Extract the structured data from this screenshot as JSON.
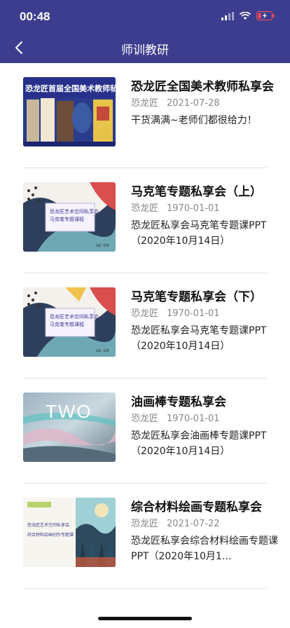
{
  "status": {
    "time": "00:48"
  },
  "nav": {
    "title": "师训教研"
  },
  "items": [
    {
      "title": "恐龙匠全国美术教师私享会",
      "author": "恐龙匠",
      "date": "2021-07-28",
      "desc": "干货满满~老师们都很给力！",
      "thumb_text": "恐龙匠首届全国美术教师私享会"
    },
    {
      "title": "马克笔专题私享会（上）",
      "author": "恐龙匠",
      "date": "1970-01-01",
      "desc": "恐龙匠私享会马克笔专题课PPT（2020年10月14日）",
      "thumb_line1": "恐龙匠艺术空间私享会",
      "thumb_line2": "马克笔专题课程",
      "thumb_sig": "uc ce"
    },
    {
      "title": "马克笔专题私享会（下）",
      "author": "恐龙匠",
      "date": "1970-01-01",
      "desc": "恐龙匠私享会马克笔专题课PPT（2020年10月14日）",
      "thumb_line1": "恐龙匠艺术空间私享会",
      "thumb_line2": "马克笔专题课程",
      "thumb_sig": "uc ce"
    },
    {
      "title": "油画棒专题私享会",
      "author": "恐龙匠",
      "date": "1970-01-01",
      "desc": "恐龙匠私享会油画棒专题课PPT（2020年10月14日）",
      "thumb_big": "TWO"
    },
    {
      "title": "综合材料绘画专题私享会",
      "author": "恐龙匠",
      "date": "2021-07-22",
      "desc": "恐龙匠私享会综合材料绘画专题课PPT（2020年10月1…",
      "thumb_line1": "恐龙匠艺术空间私享会",
      "thumb_line2": "综合材料绘画创作专题课"
    }
  ]
}
